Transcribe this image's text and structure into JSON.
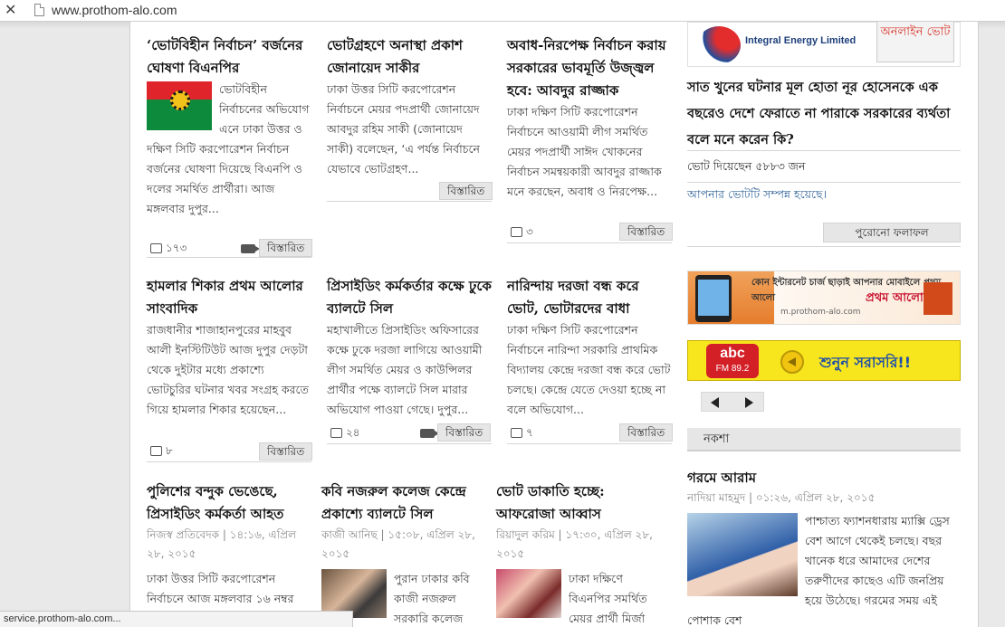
{
  "browser": {
    "url": "www.prothom-alo.com",
    "status_url": "service.prothom-alo.com..."
  },
  "articles": [
    {
      "title": "‘ভোটবিহীন নির্বাচন’ বর্জনের ঘোষণা বিএনপির",
      "summary": "ভোটবিহীন নির্বাচনের অভিযোগ এনে ঢাকা উত্তর ও দক্ষিণ সিটি করপোরেশন নির্বাচন বর্জনের ঘোষণা দিয়েছে বিএনপি ও দলের সমর্থিত প্রার্থীরা। আজ মঙ্গলবার দুপুর...",
      "comments": "১৭৩",
      "more": "বিস্তারিত"
    },
    {
      "title": "ভোটগ্রহণে অনাস্থা প্রকাশ জোনায়েদ সাকীর",
      "summary": "ঢাকা উত্তর সিটি করপোরেশন নির্বাচনে মেয়র পদপ্রার্থী জোনায়েদ আবদুর রহিম সাকী (জোনায়েদ সাকী) বলেছেন, ‘এ পর্যন্ত নির্বাচনে যেভাবে ভোটগ্রহণ...",
      "more": "বিস্তারিত"
    },
    {
      "title": "অবাধ-নিরপেক্ষ নির্বাচন করায় সরকারের ভাবমূর্তি উজ্জ্বল হবে: আবদুর রাজ্জাক",
      "summary": "ঢাকা দক্ষিণ সিটি করপোরেশন নির্বাচনে আওয়ামী লীগ সমর্থিত মেয়র পদপ্রার্থী সাঈদ খোকনের নির্বাচন সমন্বয়কারী আবদুর রাজ্জাক মনে করছেন, অবাধ ও নিরপেক্ষ...",
      "comments": "৩",
      "more": "বিস্তারিত"
    },
    {
      "title": "হামলার শিকার প্রথম আলোর সাংবাদিক",
      "summary": "রাজধানীর শাজাহানপুরের মাহবুব আলী ইনস্টিটিউট আজ দুপুর দেড়টা থেকে দুইটার মধ্যে প্রকাশ্যে ভোটচুরির ঘটনার খবর সংগ্রহ করতে গিয়ে হামলার শিকার হয়েছেন...",
      "comments": "৮",
      "more": "বিস্তারিত"
    },
    {
      "title": "প্রিসাইডিং কর্মকর্তার কক্ষে ঢুকে ব্যালটে সিল",
      "summary": "মহাখালীতে প্রিসাইডিং অফিসারের কক্ষে ঢুকে দরজা লাগিয়ে আওয়ামী লীগ সমর্থিত মেয়র ও কাউন্সিলর প্রার্থীর পক্ষে ব্যালটে সিল মারার অভিযোগ পাওয়া গেছে। দুপুর...",
      "comments": "২৪",
      "more": "বিস্তারিত"
    },
    {
      "title": "নারিন্দায় দরজা বন্ধ করে ভোট, ভোটারদের বাধা",
      "summary": "ঢাকা দক্ষিণ সিটি করপোরেশন নির্বাচনে নারিন্দা সরকারি প্রাথমিক বিদ্যালয় কেন্দ্রে দরজা বন্ধ করে ভোট চলছে। কেন্দ্রে যেতে দেওয়া হচ্ছে না বলে অভিযোগ...",
      "comments": "৭",
      "more": "বিস্তারিত"
    },
    {
      "title": "পুলিশের বন্দুক ভেঙেছে, প্রিসাইডিং কর্মকর্তা আহত",
      "meta": "নিজস্ব প্রতিবেদক | ১৪:১৬, এপ্রিল ২৮, ২০১৫",
      "summary": "ঢাকা উত্তর সিটি করপোরেশন নির্বাচনে আজ মঙ্গলবার ১৬ নম্বর"
    },
    {
      "title": "কবি নজরুল কলেজ কেন্দ্রে প্রকাশ্যে ব্যালটে সিল",
      "meta": "কাজী আনিছ | ১৫:০৮, এপ্রিল ২৮, ২০১৫",
      "summary": "পুরান ঢাকার কবি কাজী নজরুল সরকারি কলেজ"
    },
    {
      "title": "ভোট ডাকাতি হচ্ছে: আফরোজা আব্বাস",
      "meta": "রিয়াদুল করিম | ১৭:৩০, এপ্রিল ২৮, ২০১৫",
      "summary": "ঢাকা দক্ষিণে বিএনপির সমর্থিত মেয়র প্রার্থী মির্জা"
    }
  ],
  "sidebar": {
    "logo_text": "Integral Energy Limited",
    "logo_vote": "অনলাইন ভোট",
    "poll_question": "সাত খুনের ঘটনার মূল হোতা নূর হোসেনকে এক বছরেও দেশে ফেরাতে না পারাকে সরকারের ব্যর্থতা বলে মনে করেন কি?",
    "votes": "ভোট দিয়েছেন ৫৮৮৩ জন",
    "voted_message": "আপনার ভোটটি সম্পন্ন হয়েছে।",
    "old_results": "পুরোনো ফলাফল",
    "ad1_top": "কোন ইন্টারনেট চার্জ ছাড়াই আপনার মোবাইলে প্রথম আলো",
    "ad1_brand": "প্রথম আলো",
    "ad1_url": "m.prothom-alo.com",
    "radio_name": "abc",
    "radio_freq": "FM 89.2",
    "radio_cta": "শুনুন সরাসরি!!",
    "section_title": "নকশা",
    "feature_title": "গরমে আরাম",
    "feature_meta": "নাদিয়া মাহমুদ | ০১:২৬, এপ্রিল ২৮, ২০১৫",
    "feature_text": "পাশ্চাত্য ফ্যাশনধারায় ম্যাক্সি ড্রেস বেশ আগে থেকেই চলছে। বছর খানেক ধরে আমাদের দেশের তরুণীদের কাছেও এটি জনপ্রিয় হয়ে উঠেছে। গরমের সময় এই পোশাক বেশ"
  }
}
